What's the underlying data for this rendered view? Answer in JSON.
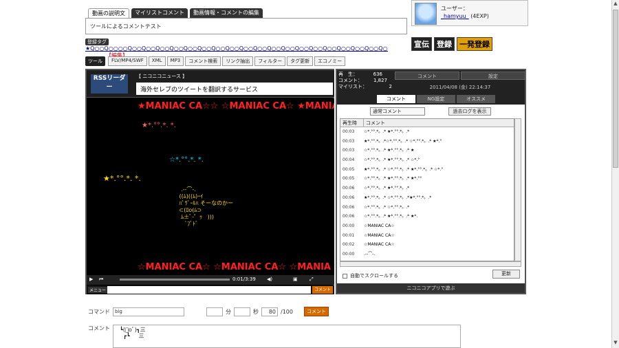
{
  "tabs": [
    {
      "label": "動画の説明文"
    },
    {
      "label": "マイリストコメント"
    },
    {
      "label": "動画情報・コメントの編集"
    }
  ],
  "description": "ツールによるコメントテスト",
  "tag_section": {
    "label": "登録タグ",
    "tags": "★Q○○Q○○○○Q○○Q○○Q○○Q○○Q○○Q○○Q○○Q○○Q○○Q○○Q○○Q○○Q○○Q○○Q○○Q○○Q○○Q○○Q○○Q○○",
    "edit_link": "【編集】"
  },
  "tools": {
    "label": "ツール",
    "buttons": [
      "FLV/MP4/SWF",
      "XML",
      "MP3",
      "コメント検索",
      "リンク抽出",
      "フィルター",
      "タグ更新",
      "エコノミー"
    ]
  },
  "user": {
    "label": "ユーザー：",
    "name": "_hamyuu_",
    "exp": "(4EXP)"
  },
  "ads": [
    "宣伝",
    "登録",
    "一発登録"
  ],
  "rss": {
    "logo": "RSSリーダー",
    "source": "【 ニコニコニュース 】",
    "headline": "海外セレブのツイートを翻訳するサービス"
  },
  "video_comments": [
    {
      "text": "★MANIAC CA☆☆ ☆MANIAC CA☆ ★MANIAC",
      "color": "#ff2020"
    },
    {
      "text": "★*.°°.*. *.",
      "color": "#ff6666"
    },
    {
      "text": "☆*.°°.*. *.",
      "color": "#00ddff"
    },
    {
      "text": "★*.°°.*. *.",
      "color": "#ffdd00"
    },
    {
      "text": "☆MANIAC CA☆ ☆MANIAC CA☆ ☆MANIA",
      "color": "#ff2020"
    }
  ],
  "player": {
    "time": "0:01/3:39",
    "menu": "メニュー",
    "comment_btn": "コメント"
  },
  "stats": {
    "play_label": "再　生：",
    "play": "636",
    "comment_label": "コメント：",
    "comment": "1,827",
    "mylist_label": "マイリスト：",
    "mylist": "2"
  },
  "panel": {
    "btn_comment": "コメント",
    "btn_settings": "設定",
    "date": "2011/04/08 (金) 22:14:37",
    "tabs": [
      "コメント",
      "NG設定",
      "オススメ"
    ],
    "filter": "通常コメント",
    "past_log": "過去ログを表示",
    "col_time": "再生時",
    "col_comment": "コメント",
    "rows": [
      {
        "time": "00:03",
        "text": "☆*.°°.*。.*     ★*.°°.*。.*"
      },
      {
        "time": "00:03",
        "text": "★*.°°.*。.*☆*.°°.*。.*     ☆*.°°.*。.*   ★*.°"
      },
      {
        "time": "00:03",
        "text": "☆*.°°.*。.*      ★*.°°.*。.*       ★"
      },
      {
        "time": "00:04",
        "text": "☆*.°°.*。.*     ★*.°°.*。.*       ☆*.°"
      },
      {
        "time": "00:05",
        "text": "★*.°°.*。.*  ☆*.°°.*。.*  ★*.°°.*。.*  ☆*.°"
      },
      {
        "time": "00:05",
        "text": "☆*.°°.*。.*       ★*.°°.*。.*  ★*.°°"
      },
      {
        "time": "00:06",
        "text": "☆*.°°.*。.*         ★*.°°.*。.*"
      },
      {
        "time": "00:06",
        "text": "★*.°°.*。.*    ☆*.°°.*。.*★*.°°.*。.*"
      },
      {
        "time": "00:06",
        "text": "☆*.°°.*。.*     ☆*.°°.*。.*"
      },
      {
        "time": "00:06",
        "text": "☆*.°°.*。.*     ★*.°°.*。.*        ★*."
      },
      {
        "time": "00:00",
        "text": "☆MANIAC CA☆"
      },
      {
        "time": "00:01",
        "text": "☆MANIAC CA☆"
      },
      {
        "time": "00:02",
        "text": "☆MANIAC CA☆"
      },
      {
        "time": "00:00",
        "text": "  .-‐⌒-. "
      }
    ],
    "autoscroll": "自動でスクロールする",
    "update": "更新",
    "footer": "ニコニコアプリで遊ぶ"
  },
  "command_bar": {
    "label": "コマンド",
    "value": "big",
    "min_label": "分",
    "sec_label": "秒",
    "frame": "80",
    "frame_total": "/100",
    "submit": "コメント"
  },
  "comment_box": {
    "label": "コメント",
    "value": "  ┗(ﾟoﾟ)┓三\n    ┏┗     三"
  }
}
